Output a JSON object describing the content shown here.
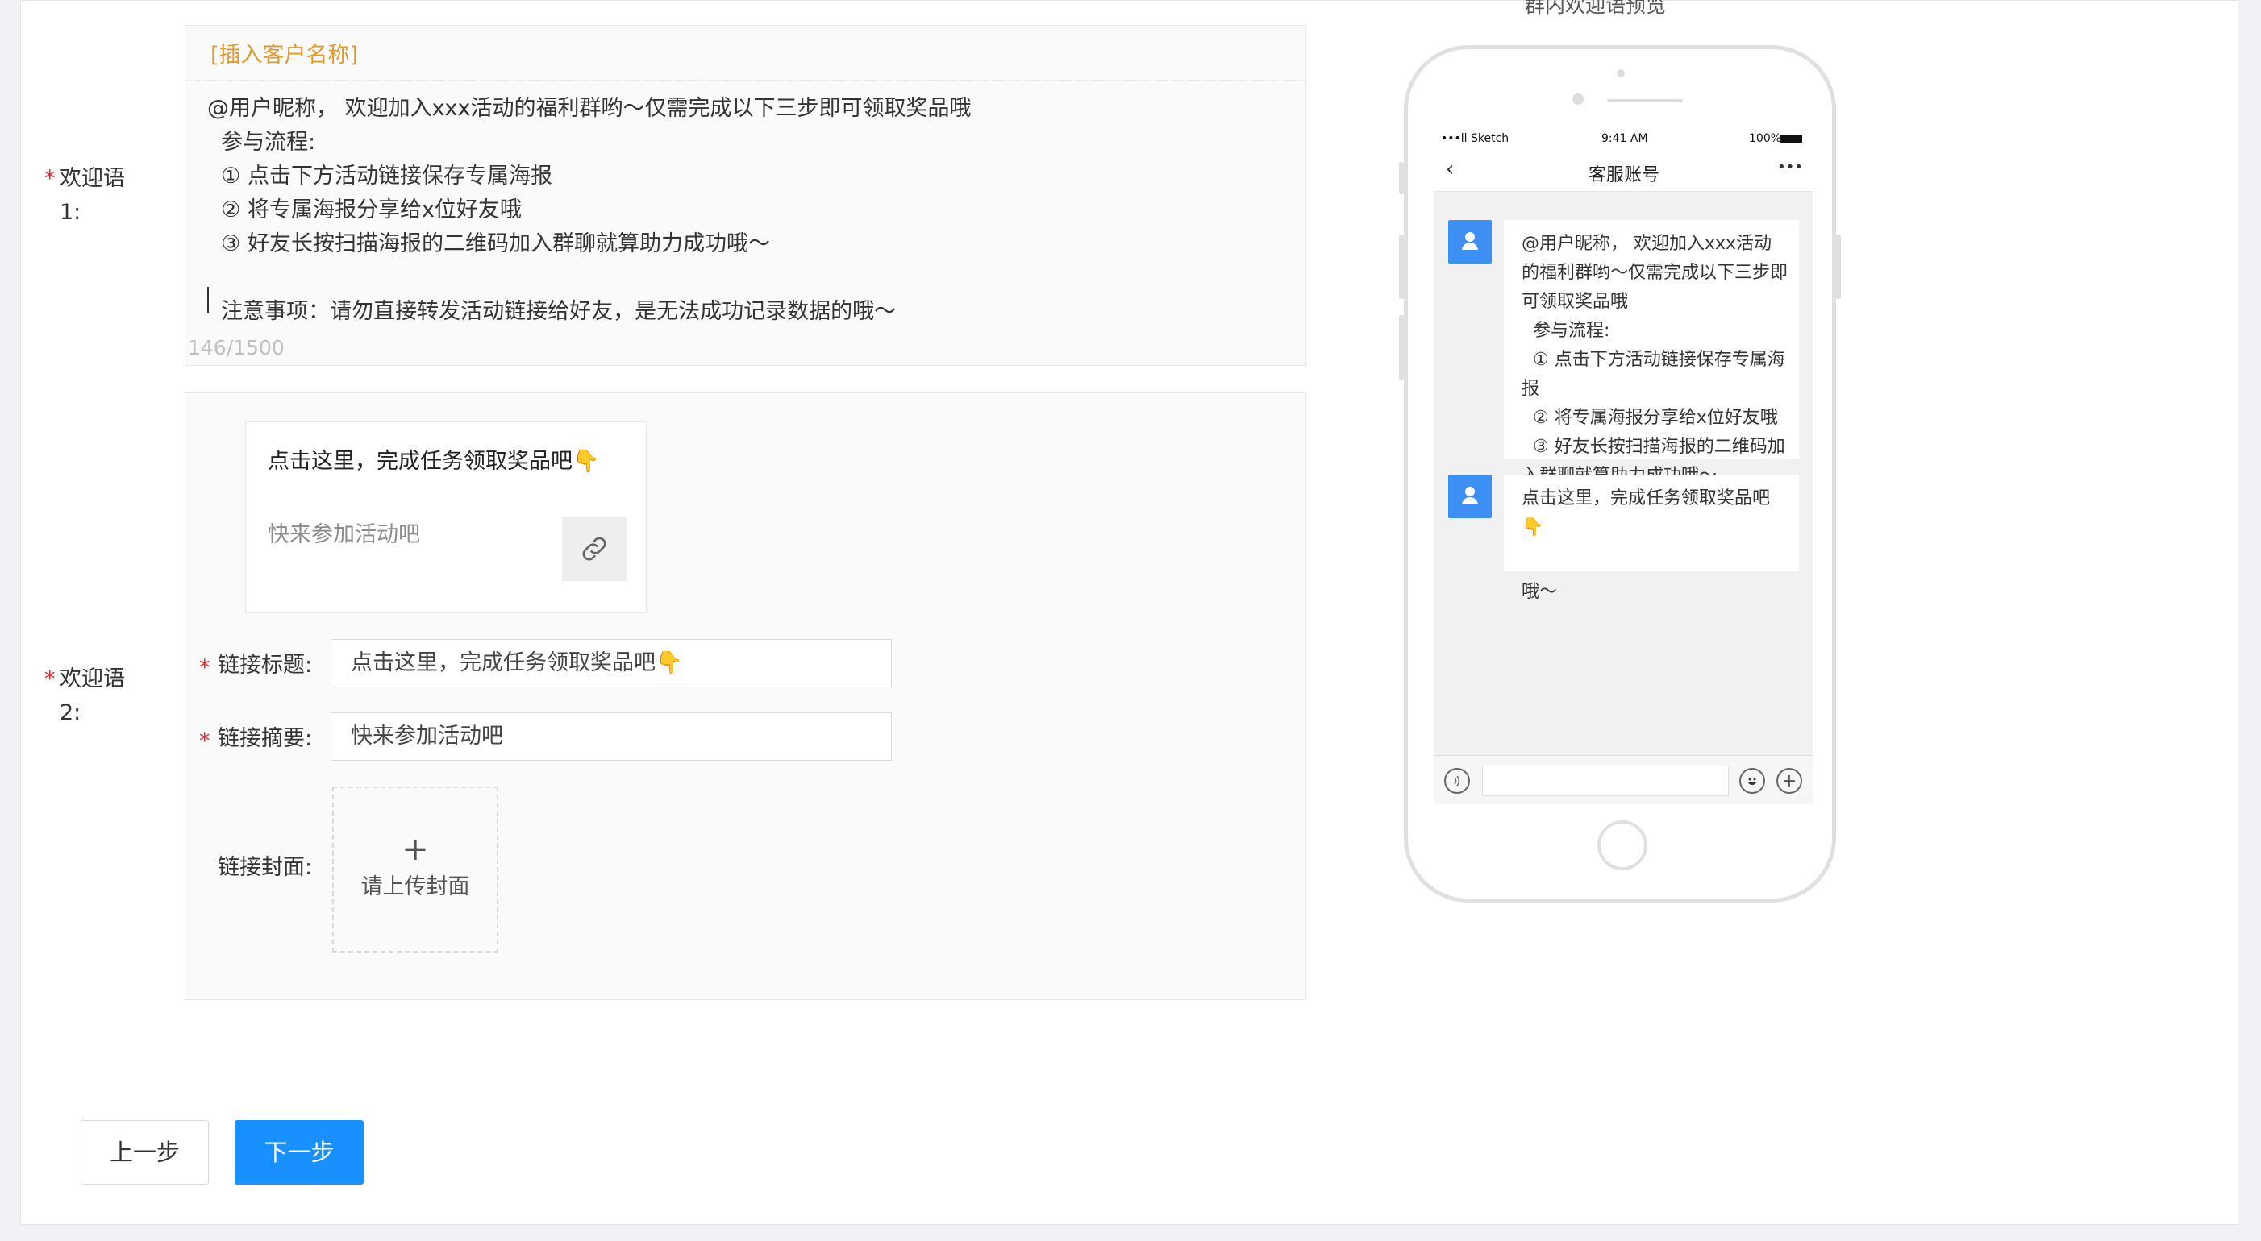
{
  "preview": {
    "title": "群内欢迎语预览",
    "status_carrier": "•••ll Sketch",
    "status_time": "9:41 AM",
    "status_battery": "100%",
    "nav_title": "客服账号",
    "nav_more": "•••",
    "message_1": "@用户昵称， 欢迎加入xxx活动的福利群哟～仅需完成以下三步即可领取奖品哦\n  参与流程:\n  ① 点击下方活动链接保存专属海报\n  ② 将专属海报分享给x位好友哦\n  ③ 好友长按扫描海报的二维码加入群聊就算助力成功哦～\n\n  注意事项：请勿直接转发活动链接给好友，是无法成功记录数据的哦～",
    "message_2": "点击这里，完成任务领取奖品吧👇"
  },
  "welcome1": {
    "required": "*",
    "label": "欢迎语\n1:",
    "insert_label": "[插入客户名称]",
    "text": "@用户昵称， 欢迎加入xxx活动的福利群哟～仅需完成以下三步即可领取奖品哦\n  参与流程:\n  ① 点击下方活动链接保存专属海报\n  ② 将专属海报分享给x位好友哦\n  ③ 好友长按扫描海报的二维码加入群聊就算助力成功哦～\n\n  注意事项：请勿直接转发活动链接给好友，是无法成功记录数据的哦～",
    "counter": "146/1500"
  },
  "welcome2": {
    "required": "*",
    "label": "欢迎语\n2:",
    "card_title": "点击这里，完成任务领取奖品吧👇",
    "card_desc": "快来参加活动吧",
    "title_field": {
      "required": "*",
      "label": "链接标题:",
      "value": "点击这里，完成任务领取奖品吧👇"
    },
    "summary_field": {
      "required": "*",
      "label": "链接摘要:",
      "value": "快来参加活动吧"
    },
    "cover_field": {
      "label": "链接封面:",
      "plus": "+",
      "upload_text": "请上传封面"
    }
  },
  "buttons": {
    "prev": "上一步",
    "next": "下一步"
  },
  "colors": {
    "primary": "#1890ff",
    "required": "#f5222d",
    "insert": "#e09a2c",
    "avatar": "#3d8ff3"
  }
}
